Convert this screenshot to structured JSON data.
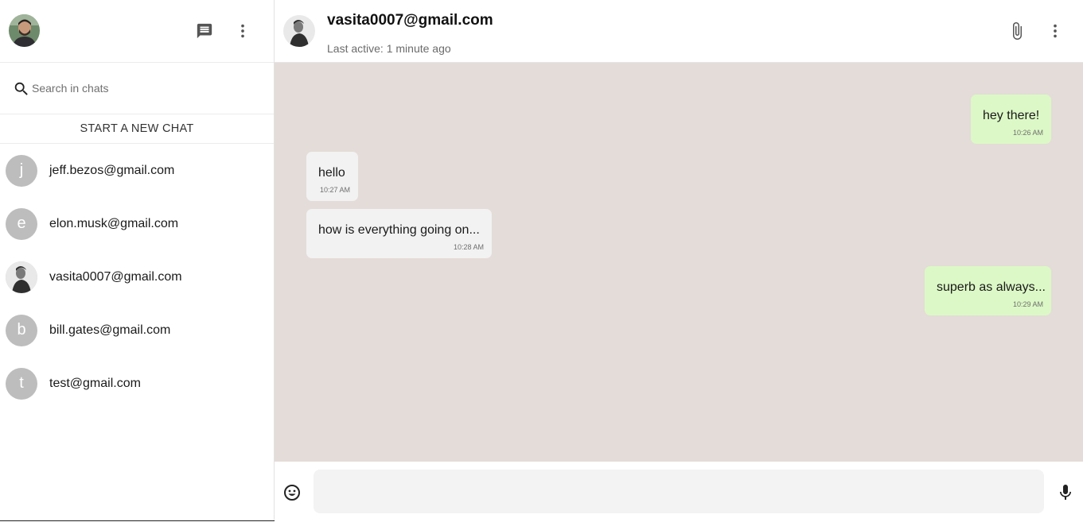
{
  "sidebar": {
    "search_placeholder": "Search in chats",
    "new_chat_label": "START A NEW CHAT",
    "chats": [
      {
        "initial": "j",
        "name": "jeff.bezos@gmail.com"
      },
      {
        "initial": "e",
        "name": "elon.musk@gmail.com"
      },
      {
        "initial": "",
        "name": "vasita0007@gmail.com"
      },
      {
        "initial": "b",
        "name": "bill.gates@gmail.com"
      },
      {
        "initial": "t",
        "name": "test@gmail.com"
      }
    ]
  },
  "chat": {
    "peer_name": "vasita0007@gmail.com",
    "peer_status": "Last active: 1 minute ago",
    "messages": [
      {
        "direction": "out",
        "text": "hey there!",
        "time": "10:26 AM"
      },
      {
        "direction": "in",
        "text": "hello",
        "time": "10:27 AM"
      },
      {
        "direction": "in",
        "text": "how is everything going on...",
        "time": "10:28 AM"
      },
      {
        "direction": "out",
        "text": "superb as always...",
        "time": "10:29 AM"
      }
    ],
    "composer_value": ""
  },
  "colors": {
    "chat_background": "#e4dcd8",
    "outgoing_bubble": "#dcf8c6",
    "incoming_bubble": "#f2f2f2",
    "avatar_placeholder": "#bdbdbd",
    "icon": "#555555"
  },
  "icons": {
    "sidebar_header": [
      "chat-icon",
      "more-vert-icon"
    ],
    "search": "search-icon",
    "chat_header": [
      "attach-icon",
      "more-vert-icon"
    ],
    "composer": [
      "emoji-icon",
      "mic-icon"
    ]
  }
}
